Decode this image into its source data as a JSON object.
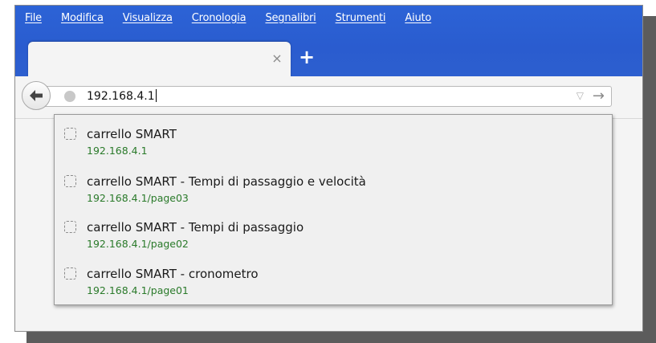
{
  "menu": {
    "items": [
      {
        "label": "File"
      },
      {
        "label": "Modifica"
      },
      {
        "label": "Visualizza"
      },
      {
        "label": "Cronologia"
      },
      {
        "label": "Segnalibri"
      },
      {
        "label": "Strumenti"
      },
      {
        "label": "Aiuto"
      }
    ]
  },
  "tab": {
    "close_icon": "close-icon",
    "close_glyph": "×"
  },
  "newtab": {
    "glyph": "+"
  },
  "navigation": {
    "back_glyph": "back-arrow-icon"
  },
  "urlbar": {
    "value": "192.168.4.1",
    "dropmarker_glyph": "▽",
    "go_glyph": "→"
  },
  "suggestions": [
    {
      "title": "carrello SMART",
      "url": "192.168.4.1"
    },
    {
      "title": "carrello SMART - Tempi di passaggio e velocità",
      "url": "192.168.4.1/page03"
    },
    {
      "title": "carrello SMART - Tempi di passaggio",
      "url": "192.168.4.1/page02"
    },
    {
      "title": "carrello SMART - cronometro",
      "url": "192.168.4.1/page01"
    }
  ],
  "colors": {
    "titlebar": "#2a5ccf",
    "suggestion_url": "#2a7a2a",
    "popup_bg": "#f0f0f0"
  }
}
